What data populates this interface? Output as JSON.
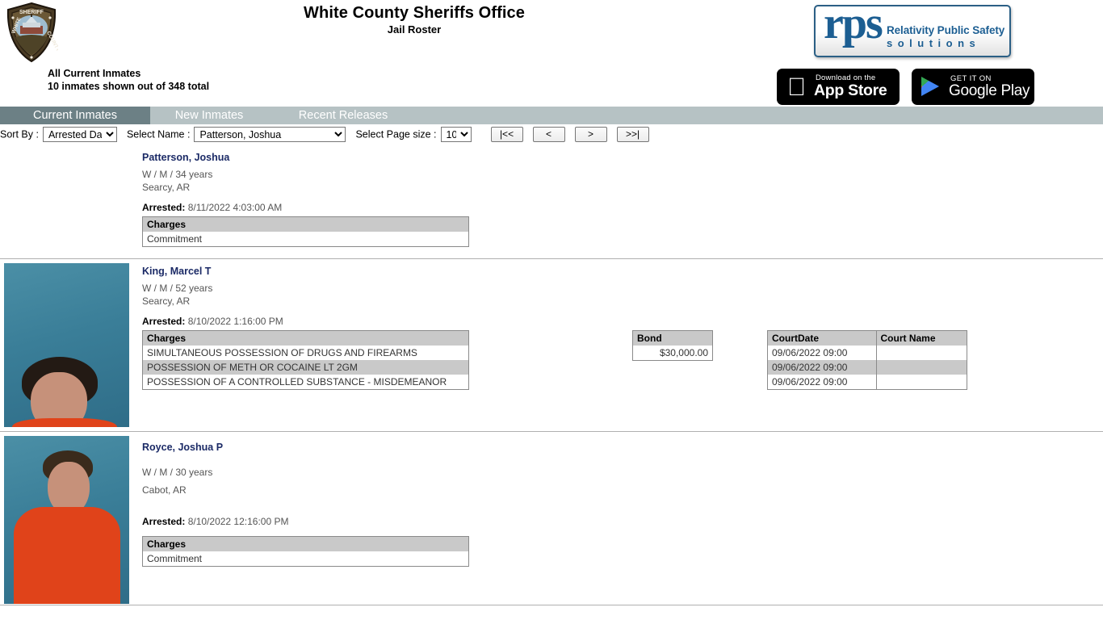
{
  "header": {
    "badge_alt": "white-county-sheriff-badge",
    "title": "White County Sheriffs Office",
    "subtitle": "Jail Roster",
    "summary_line1": "All Current Inmates",
    "summary_line2": "10 inmates shown out of 348 total"
  },
  "branding": {
    "rps_mark": "rps",
    "rps_ghost": "RPS",
    "rps_line1": "Relativity Public Safety",
    "rps_line2": "solutions",
    "app_store": {
      "small": "Download on the",
      "big": "App Store"
    },
    "google_play": {
      "small": "GET IT ON",
      "big": "Google Play"
    }
  },
  "tabs": [
    {
      "id": "current",
      "label": "Current Inmates",
      "active": true
    },
    {
      "id": "new",
      "label": "New Inmates",
      "active": false
    },
    {
      "id": "releases",
      "label": "Recent Releases",
      "active": false
    }
  ],
  "controls": {
    "sort_by_label": "Sort By :",
    "sort_by_value": "Arrested Date",
    "sort_by_options": [
      "Arrested Date"
    ],
    "select_name_label": "Select Name :",
    "select_name_value": "Patterson, Joshua",
    "select_name_options": [
      "Patterson, Joshua"
    ],
    "page_size_label": "Select Page size :",
    "page_size_value": "10",
    "page_size_options": [
      "10"
    ],
    "pager": {
      "first": "|<<",
      "prev": "<",
      "next": ">",
      "last": ">>|"
    }
  },
  "table_headers": {
    "charges": "Charges",
    "bond": "Bond",
    "court_date": "CourtDate",
    "court_name": "Court Name"
  },
  "labels": {
    "arrested": "Arrested:"
  },
  "colors": {
    "tab_bar": "#b6c2c4",
    "tab_active": "#6c8085",
    "name_link": "#1b2a66",
    "table_header": "#c9c9c9",
    "rps_blue": "#1c5e92"
  },
  "records": [
    {
      "name": "Patterson, Joshua",
      "demographics": "W / M / 34 years",
      "city": "Searcy, AR",
      "arrested": "8/11/2022 4:03:00 AM",
      "has_photo": false,
      "charges": [
        "Commitment"
      ],
      "bond": null,
      "court_dates": []
    },
    {
      "name": "King, Marcel T",
      "demographics": "W / M / 52 years",
      "city": "Searcy, AR",
      "arrested": "8/10/2022 1:16:00 PM",
      "has_photo": true,
      "charges": [
        "SIMULTANEOUS POSSESSION OF DRUGS AND FIREARMS",
        "POSSESSION OF METH OR COCAINE LT 2GM",
        "POSSESSION OF A CONTROLLED SUBSTANCE - MISDEMEANOR"
      ],
      "bond": "$30,000.00",
      "court_dates": [
        {
          "date": "09/06/2022 09:00",
          "court": ""
        },
        {
          "date": "09/06/2022 09:00",
          "court": ""
        },
        {
          "date": "09/06/2022 09:00",
          "court": ""
        }
      ]
    },
    {
      "name": "Royce, Joshua P",
      "demographics": "W / M / 30 years",
      "city": "Cabot, AR",
      "arrested": "8/10/2022 12:16:00 PM",
      "has_photo": true,
      "charges": [
        "Commitment"
      ],
      "bond": null,
      "court_dates": []
    }
  ]
}
